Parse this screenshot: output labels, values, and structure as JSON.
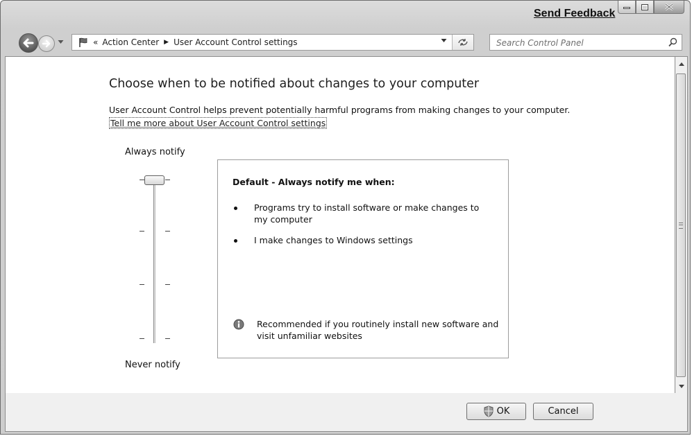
{
  "titlebar": {
    "feedback_label": "Send Feedback",
    "minimize_icon": "minimize-icon",
    "maximize_icon": "maximize-icon",
    "close_icon": "close-icon"
  },
  "navbar": {
    "address_chevron": "«",
    "breadcrumb": [
      "Action Center",
      "User Account Control settings"
    ],
    "breadcrumb_separator": "▶",
    "search_placeholder": "Search Control Panel"
  },
  "main": {
    "heading": "Choose when to be notified about changes to your computer",
    "description": "User Account Control helps prevent potentially harmful programs from making changes to your computer.",
    "learn_more_link": "Tell me more about User Account Control settings",
    "slider": {
      "top_label": "Always notify",
      "bottom_label": "Never notify",
      "levels": 4,
      "selected_level": 4
    },
    "info": {
      "title": "Default - Always notify me when:",
      "bullets": [
        "Programs try to install software or make changes to my computer",
        "I make changes to Windows settings"
      ],
      "recommendation": "Recommended if you routinely install new software and visit unfamiliar websites"
    }
  },
  "footer": {
    "ok_label": "OK",
    "cancel_label": "Cancel"
  }
}
